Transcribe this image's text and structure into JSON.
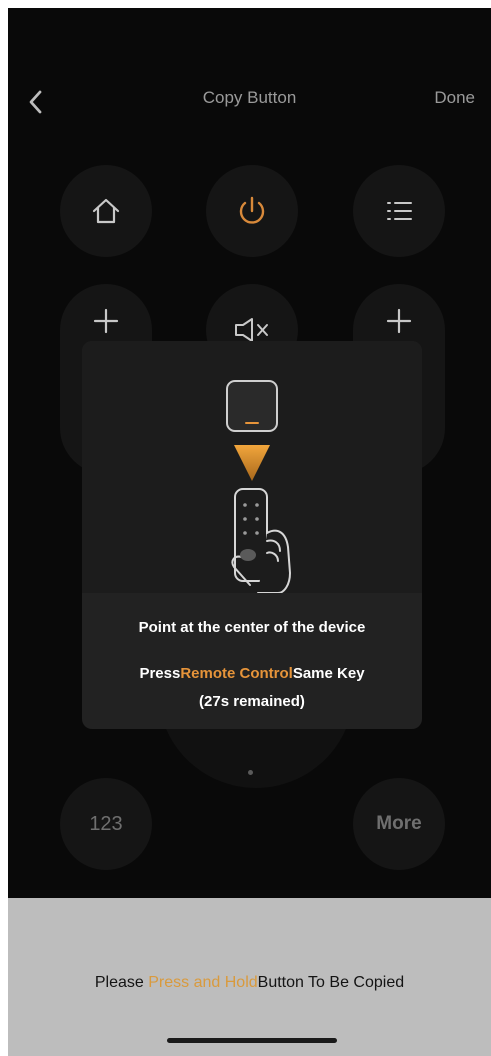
{
  "nav": {
    "title": "Copy Button",
    "done_label": "Done"
  },
  "remote": {
    "row1": [
      {
        "icon": "home-icon"
      },
      {
        "icon": "power-icon",
        "color": "#d8893a"
      },
      {
        "icon": "menu-list-icon"
      }
    ],
    "left_tall": {
      "icon": "plus-icon"
    },
    "mute": {
      "icon": "mute-icon"
    },
    "right_tall": {
      "icon": "plus-icon"
    },
    "num_label": "123",
    "more_label": "More"
  },
  "dialog": {
    "line1": "Point at the center of the device",
    "line2_pre": "Press",
    "line2_accent": "Remote Control",
    "line2_post": "Same Key",
    "line3": "(27s remained)",
    "accent_color": "#e6943a"
  },
  "bottom": {
    "hint_pre": "Please ",
    "hint_accent": "Press and Hold",
    "hint_post": "Button To Be Copied"
  }
}
